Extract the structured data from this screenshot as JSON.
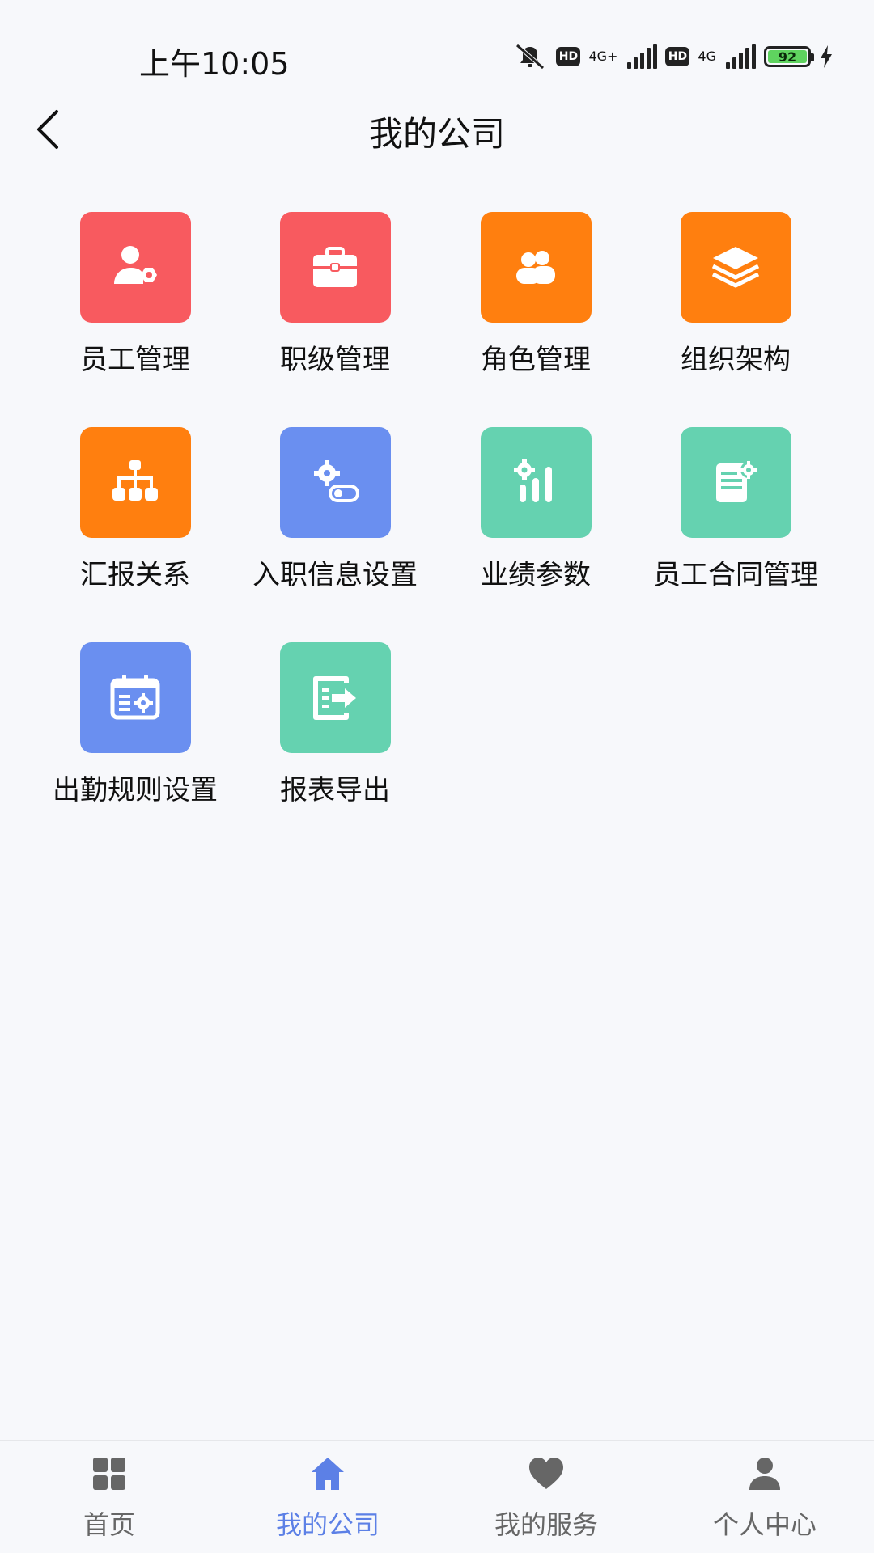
{
  "status_bar": {
    "time": "上午10:05",
    "network_1": "4G+",
    "network_2": "4G",
    "hd": "HD",
    "battery": "92"
  },
  "header": {
    "title": "我的公司"
  },
  "colors": {
    "red": "#f85a5f",
    "orange": "#ff7f0f",
    "blue": "#6a8ff0",
    "green": "#65d2b0",
    "tab_active": "#5c80e6",
    "tab_inactive": "#666666"
  },
  "grid": {
    "items": [
      {
        "label": "员工管理",
        "icon": "user-settings-icon",
        "color": "red"
      },
      {
        "label": "职级管理",
        "icon": "briefcase-icon",
        "color": "red"
      },
      {
        "label": "角色管理",
        "icon": "users-icon",
        "color": "orange"
      },
      {
        "label": "组织架构",
        "icon": "layers-icon",
        "color": "orange"
      },
      {
        "label": "汇报关系",
        "icon": "hierarchy-icon",
        "color": "orange"
      },
      {
        "label": "入职信息设置",
        "icon": "gear-toggle-icon",
        "color": "blue"
      },
      {
        "label": "业绩参数",
        "icon": "gear-chart-icon",
        "color": "green"
      },
      {
        "label": "员工合同管理",
        "icon": "document-gear-icon",
        "color": "green"
      },
      {
        "label": "出勤规则设置",
        "icon": "calendar-gear-icon",
        "color": "blue"
      },
      {
        "label": "报表导出",
        "icon": "export-icon",
        "color": "green"
      }
    ]
  },
  "tabs": [
    {
      "label": "首页",
      "icon": "grid-icon",
      "active": false
    },
    {
      "label": "我的公司",
      "icon": "home-icon",
      "active": true
    },
    {
      "label": "我的服务",
      "icon": "heart-icon",
      "active": false
    },
    {
      "label": "个人中心",
      "icon": "person-icon",
      "active": false
    }
  ]
}
